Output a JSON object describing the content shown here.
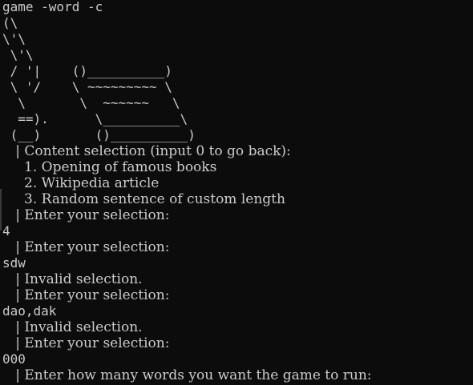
{
  "window": {
    "background": "#0c0c0c",
    "text_color": "#cccccc"
  },
  "terminal": {
    "command": "game -word -c",
    "ascii_art": [
      "(\\",
      "\\'\\",
      " \\'\\",
      " / '|    ()__________)",
      " \\ '/    \\ ~~~~~~~~~ \\",
      "  \\       \\  ~~~~~~   \\",
      "  ==).      \\__________\\",
      " (__)       ()__________)"
    ],
    "menu": {
      "header": "   | Content selection (input 0 to go back):",
      "options": [
        "     1. Opening of famous books",
        "     2. Wikipedia article",
        "     3. Random sentence of custom length"
      ],
      "prompt": "   | Enter your selection:"
    },
    "session": [
      {
        "type": "input",
        "text": "4"
      },
      {
        "type": "output",
        "text": "   | Enter your selection:"
      },
      {
        "type": "input",
        "text": "sdw"
      },
      {
        "type": "output",
        "text": "   | Invalid selection."
      },
      {
        "type": "output",
        "text": "   | Enter your selection:"
      },
      {
        "type": "input",
        "text": "dao,dak"
      },
      {
        "type": "output",
        "text": "   | Invalid selection."
      },
      {
        "type": "output",
        "text": "   | Enter your selection:"
      },
      {
        "type": "input",
        "text": "000"
      },
      {
        "type": "output",
        "text": "   | Enter how many words you want the game to run:"
      }
    ]
  }
}
